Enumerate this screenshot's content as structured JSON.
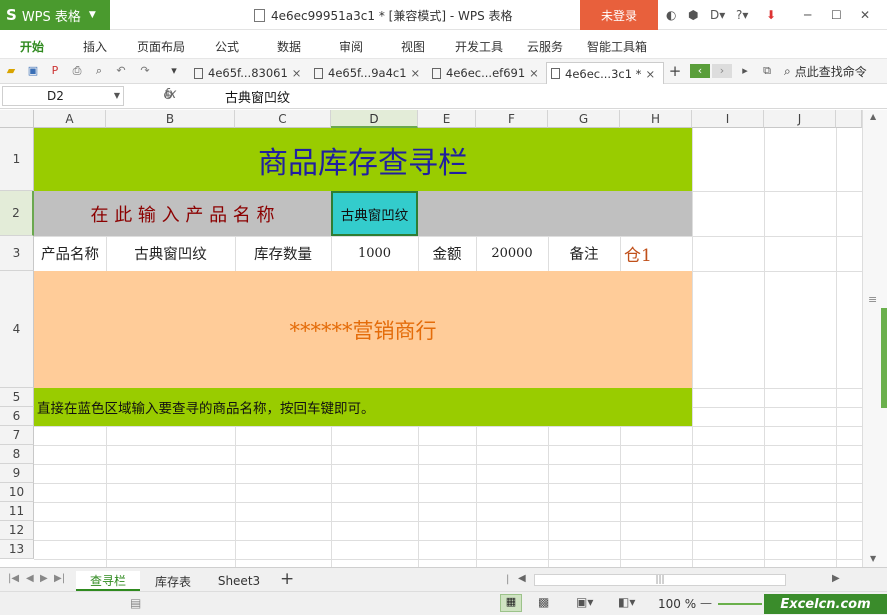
{
  "app": {
    "name": "WPS 表格",
    "window_title": "4e6ec99951a3c1 * [兼容模式] - WPS 表格",
    "login_label": "未登录"
  },
  "menu": [
    "开始",
    "插入",
    "页面布局",
    "公式",
    "数据",
    "审阅",
    "视图",
    "开发工具",
    "云服务",
    "智能工具箱"
  ],
  "doc_tabs": [
    {
      "label": "4e65f...83061"
    },
    {
      "label": "4e65f...9a4c1"
    },
    {
      "label": "4e6ec...ef691"
    },
    {
      "label": "4e6ec...3c1 *"
    }
  ],
  "search_command": "点此查找命令",
  "formula_bar": {
    "cell_ref": "D2",
    "fx": "fx",
    "value": "古典窗凹纹"
  },
  "columns": [
    "A",
    "B",
    "C",
    "D",
    "E",
    "F",
    "G",
    "H",
    "I",
    "J"
  ],
  "rows": [
    "1",
    "2",
    "3",
    "4",
    "5",
    "6",
    "7",
    "8",
    "9",
    "10",
    "11",
    "12",
    "13"
  ],
  "cells": {
    "title": "商品库存查寻栏",
    "prompt": "在 此 输 入 产 品 名 称",
    "input_value": "古典窗凹纹",
    "row3": [
      "产品名称",
      "古典窗凹纹",
      "库存数量",
      "1000",
      "金额",
      "20000",
      "备注",
      "仓1"
    ],
    "banner": "******营销商行",
    "instruction": "直接在蓝色区域输入要查寻的商品名称，按回车键即可。"
  },
  "sheets": [
    "查寻栏",
    "库存表",
    "Sheet3"
  ],
  "status": {
    "zoom": "100 %",
    "watermark": "Excelcn.com"
  },
  "colors": {
    "accent_green": "#4a9a2e",
    "title_band": "#99cc00",
    "input_band": "#c0c0c0",
    "input_cell": "#33cccc",
    "banner_band": "#ffcc99",
    "title_text": "#2020a0",
    "prompt_text": "#8b0000",
    "banner_text": "#e46c0a",
    "login_btn": "#e8603c"
  }
}
